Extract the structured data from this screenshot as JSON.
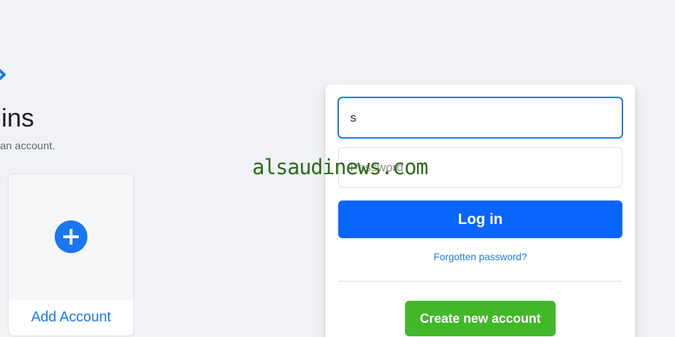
{
  "brand": {
    "logo_icon": "facebook-logo-fragment",
    "accent_color": "#1877f2"
  },
  "left": {
    "title_fragment": "jins",
    "subtitle_fragment": "an account.",
    "add_account_label": "Add Account",
    "add_icon": "plus-icon"
  },
  "login": {
    "email_value": "s",
    "password_placeholder": "Password",
    "login_label": "Log in",
    "forgot_label": "Forgotten password?",
    "create_label": "Create new account"
  },
  "watermark": {
    "text": "alsaudinews.com"
  },
  "colors": {
    "primary_button": "#0866ff",
    "create_button": "#42b72a",
    "background": "#f0f2f5"
  }
}
